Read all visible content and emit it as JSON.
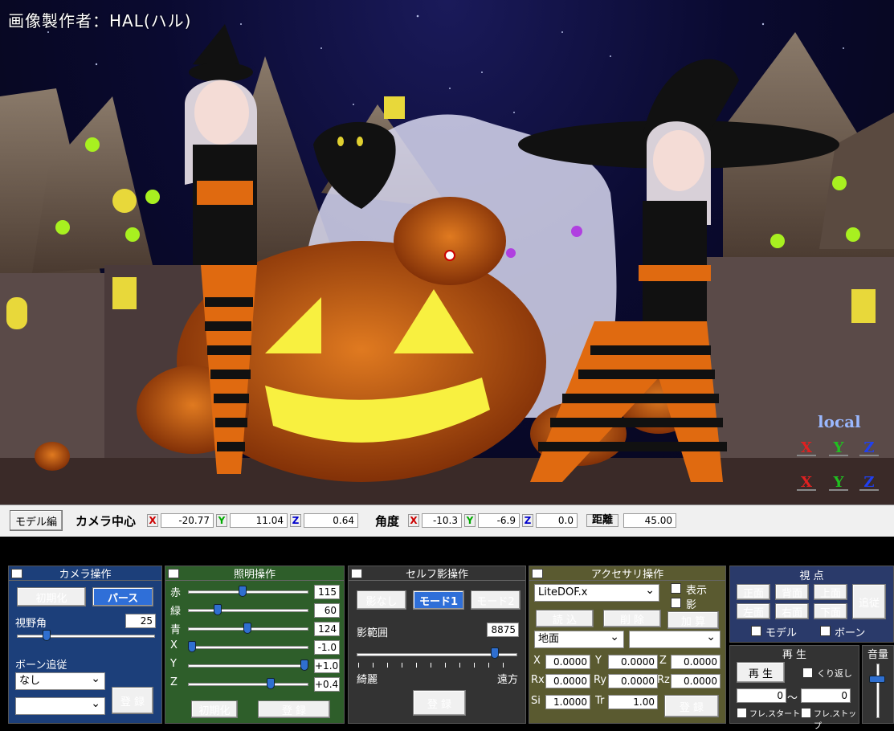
{
  "viewport": {
    "watermark": "画像製作者：HAL(ハル)",
    "local_label": "local",
    "axis_x": "X",
    "axis_y": "Y",
    "axis_z": "Z"
  },
  "infobar": {
    "model_edit": "モデル編",
    "camera_center": "カメラ中心",
    "cx": "-20.77",
    "cy": "11.04",
    "cz": "0.64",
    "angle": "角度",
    "ax": "-10.3",
    "ay": "-6.9",
    "az": "0.0",
    "distance": "距離",
    "dist": "45.00",
    "x": "X",
    "y": "Y",
    "z": "Z"
  },
  "camera": {
    "title": "カメラ操作",
    "init": "初期化",
    "perspective": "パース",
    "fov_label": "視野角",
    "fov": "25",
    "bone_follow": "ボーン追従",
    "bone_select": "なし",
    "register": "登 録",
    "minimize": "−"
  },
  "lighting": {
    "title": "照明操作",
    "rows": [
      {
        "label": "赤",
        "value": "115",
        "frac": 0.45
      },
      {
        "label": "緑",
        "value": "60",
        "frac": 0.23
      },
      {
        "label": "青",
        "value": "124",
        "frac": 0.49
      },
      {
        "label": "X",
        "value": "-1.0",
        "frac": 0.0
      },
      {
        "label": "Y",
        "value": "+1.0",
        "frac": 1.0
      },
      {
        "label": "Z",
        "value": "+0.4",
        "frac": 0.7
      }
    ],
    "init": "初期化",
    "register": "登 録",
    "minimize": "−"
  },
  "selfshadow": {
    "title": "セルフ影操作",
    "none": "影なし",
    "mode1": "モード1",
    "mode2": "モード2",
    "range_label": "影範囲",
    "range": "8875",
    "range_frac": 0.88,
    "near": "綺麗",
    "far": "遠方",
    "register": "登 録",
    "minimize": "−"
  },
  "accessory": {
    "title": "アクセサリ操作",
    "selected": "LiteDOF.x",
    "show": "表示",
    "shadow": "影",
    "load": "読 込",
    "delete": "削 除",
    "add": "加 算",
    "parent": "地面",
    "parent2": "",
    "x_label": "X",
    "x": "0.0000",
    "y_label": "Y",
    "y": "0.0000",
    "z_label": "Z",
    "z": "0.0000",
    "rx_label": "Rx",
    "rx": "0.0000",
    "ry_label": "Ry",
    "ry": "0.0000",
    "rz_label": "Rz",
    "rz": "0.0000",
    "si_label": "Si",
    "si": "1.0000",
    "tr_label": "Tr",
    "tr": "1.00",
    "register": "登 録",
    "minimize": "−",
    "check": "✓"
  },
  "view": {
    "title": "視 点",
    "front": "正面",
    "back": "背面",
    "top": "上面",
    "left": "左面",
    "right": "右面",
    "bottom": "下面",
    "follow": "追従",
    "model": "モデル",
    "bone": "ボーン"
  },
  "playback": {
    "title": "再 生",
    "play": "再 生",
    "loop": "くり返し",
    "from": "0",
    "tilde": "〜",
    "to": "0",
    "frame_start": "フレ.スタート",
    "frame_stop": "フレ.ストップ"
  },
  "volume": {
    "title": "音量",
    "level": 0.75
  }
}
